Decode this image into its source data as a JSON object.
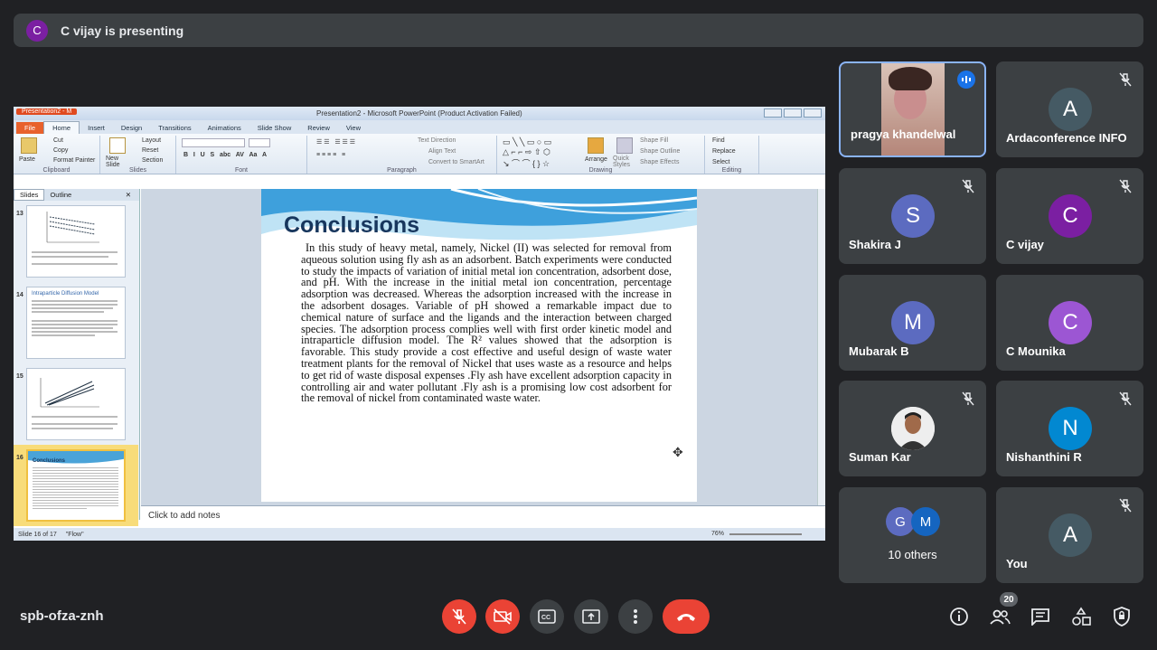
{
  "banner": {
    "avatar_initial": "C",
    "text": "C vijay is presenting"
  },
  "ppt": {
    "title_short": "Presentation2 - M",
    "window_title": "Presentation2 - Microsoft PowerPoint (Product Activation Failed)",
    "tabs": [
      "File",
      "Home",
      "Insert",
      "Design",
      "Transitions",
      "Animations",
      "Slide Show",
      "Review",
      "View"
    ],
    "ribbon": {
      "paste": "Paste",
      "cut": "Cut",
      "copy": "Copy",
      "format_painter": "Format Painter",
      "new_slide": "New Slide",
      "layout": "Layout",
      "reset": "Reset",
      "section": "Section",
      "text_direction": "Text Direction",
      "align_text": "Align Text",
      "convert_smartart": "Convert to SmartArt",
      "arrange": "Arrange",
      "quick_styles": "Quick Styles",
      "shape_fill": "Shape Fill",
      "shape_outline": "Shape Outline",
      "shape_effects": "Shape Effects",
      "find": "Find",
      "replace": "Replace",
      "select": "Select",
      "groups": [
        "Clipboard",
        "Slides",
        "Font",
        "Paragraph",
        "Drawing",
        "Editing"
      ]
    },
    "pane_tabs": [
      "Slides",
      "Outline"
    ],
    "thumb_numbers": [
      "13",
      "14",
      "15",
      "16"
    ],
    "thumb14_title": "Intraparticle Diffusion Model",
    "thumb16_title": "Conclusions",
    "slide_title": "Conclusions",
    "slide_body": "In this study of heavy metal, namely, Nickel (II) was selected for removal from aqueous solution using fly ash as an adsorbent. Batch experiments were conducted to study the impacts of variation of initial metal ion concentration, adsorbent dose, and pH. With the increase in the initial metal ion concentration, percentage adsorption was decreased. Whereas the adsorption increased with the increase in the adsorbent dosages. Variable of pH showed a remarkable impact due to chemical nature of surface and the ligands and the interaction between charged species. The adsorption process complies well with first order kinetic model and intraparticle diffusion model. The R² values showed that the adsorption is favorable. This study provide a cost effective and useful design of waste water treatment plants for the removal of Nickel that uses waste as a resource and helps to get rid of waste disposal expenses .Fly ash have excellent adsorption capacity in controlling air and water pollutant .Fly ash is a promising low cost adsorbent for the removal of nickel from contaminated waste water.",
    "notes_placeholder": "Click to add notes",
    "status_slide": "Slide 16 of 17",
    "status_theme": "\"Flow\"",
    "zoom": "76%"
  },
  "participants": [
    {
      "name": "pragya khandelwal",
      "initial": "",
      "color": "#c98e8e",
      "speaking": true
    },
    {
      "name": "Ardaconference INFO",
      "initial": "A",
      "color": "#455a64",
      "muted": true
    },
    {
      "name": "Shakira J",
      "initial": "S",
      "color": "#5c6bc0",
      "muted": true
    },
    {
      "name": "C vijay",
      "initial": "C",
      "color": "#7b1fa2",
      "muted": true
    },
    {
      "name": "Mubarak B",
      "initial": "M",
      "color": "#5c6bc0"
    },
    {
      "name": "C Mounika",
      "initial": "C",
      "color": "#9c56d3"
    },
    {
      "name": "Suman Kar",
      "initial": "",
      "color": "#a06a4a",
      "muted": true
    },
    {
      "name": "Nishanthini R",
      "initial": "N",
      "color": "#0288d1",
      "muted": true
    },
    {
      "name": "10 others",
      "initials": [
        "G",
        "M"
      ],
      "colors": [
        "#5c6bc0",
        "#1565c0"
      ]
    },
    {
      "name": "You",
      "initial": "A",
      "color": "#455a64",
      "muted": true
    }
  ],
  "bottom": {
    "meeting_code": "spb-ofza-znh",
    "people_count": "20"
  }
}
